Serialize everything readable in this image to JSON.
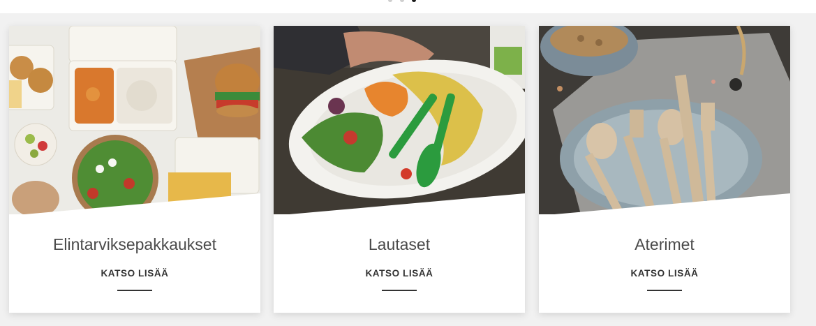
{
  "carousel": {
    "dots": [
      {
        "active": false
      },
      {
        "active": false
      },
      {
        "active": true
      }
    ]
  },
  "cards": [
    {
      "title": "Elintarviksepakkaukset",
      "cta": "KATSO LISÄÄ",
      "image": "food-packaging-photo"
    },
    {
      "title": "Lautaset",
      "cta": "KATSO LISÄÄ",
      "image": "plate-photo"
    },
    {
      "title": "Aterimet",
      "cta": "KATSO LISÄÄ",
      "image": "cutlery-photo"
    }
  ],
  "colors": {
    "title": "#4a4a4a",
    "cta": "#333333",
    "dot_active": "#1a1a1a",
    "dot_inactive": "#cfcfcf"
  }
}
